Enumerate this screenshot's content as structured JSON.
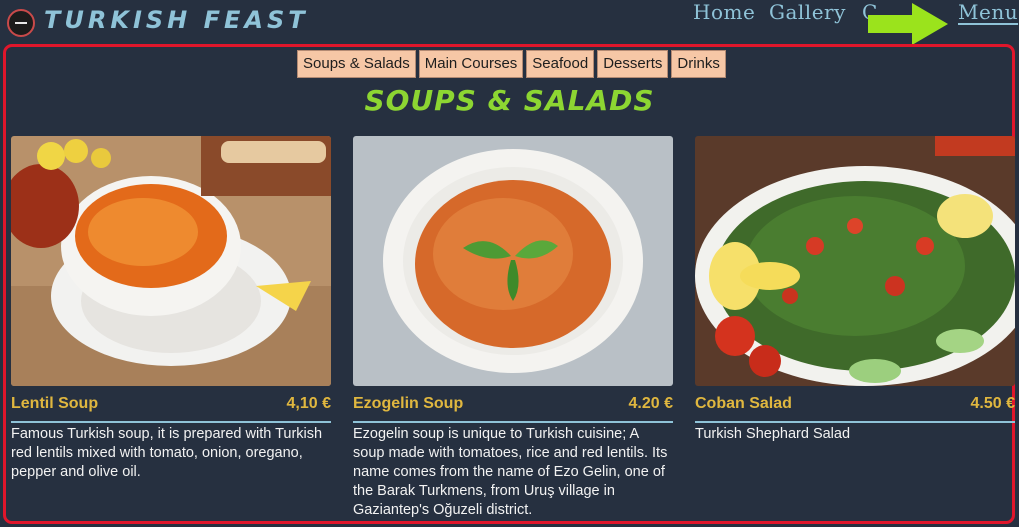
{
  "header": {
    "logo_text": "Turkish Feast",
    "nav": [
      {
        "label": "Home"
      },
      {
        "label": "Gallery"
      },
      {
        "label": "C"
      },
      {
        "label": "Menu"
      }
    ]
  },
  "menu": {
    "tabs": [
      "Soups & Salads",
      "Main Courses",
      "Seafood",
      "Desserts",
      "Drinks"
    ],
    "section_title": "Soups & Salads",
    "items": [
      {
        "name": "Lentil Soup",
        "price": "4,10 €",
        "description": "Famous Turkish soup, it is prepared with Turkish red lentils mixed with tomato, onion, oregano, pepper and olive oil."
      },
      {
        "name": "Ezogelin Soup",
        "price": "4.20 €",
        "description": "Ezogelin soup is unique to Turkish cuisine; A soup made with tomatoes, rice and red lentils. Its name comes from the name of Ezo Gelin, one of the Barak Turkmens, from Uruş village in Gaziantep's Oğuzeli district."
      },
      {
        "name": "Coban Salad",
        "price": "4.50 €",
        "description": "Turkish Shephard Salad"
      }
    ]
  },
  "colors": {
    "background": "#263040",
    "accent_blue": "#8fc3d8",
    "title_green": "#8dd632",
    "price_gold": "#e0b73f",
    "tab_peach": "#f6c7a6",
    "frame_red": "#e0162b",
    "arrow_green": "#9be31c"
  },
  "icons": {
    "logo": "logo-icon",
    "annotation": "arrow-right-icon"
  }
}
